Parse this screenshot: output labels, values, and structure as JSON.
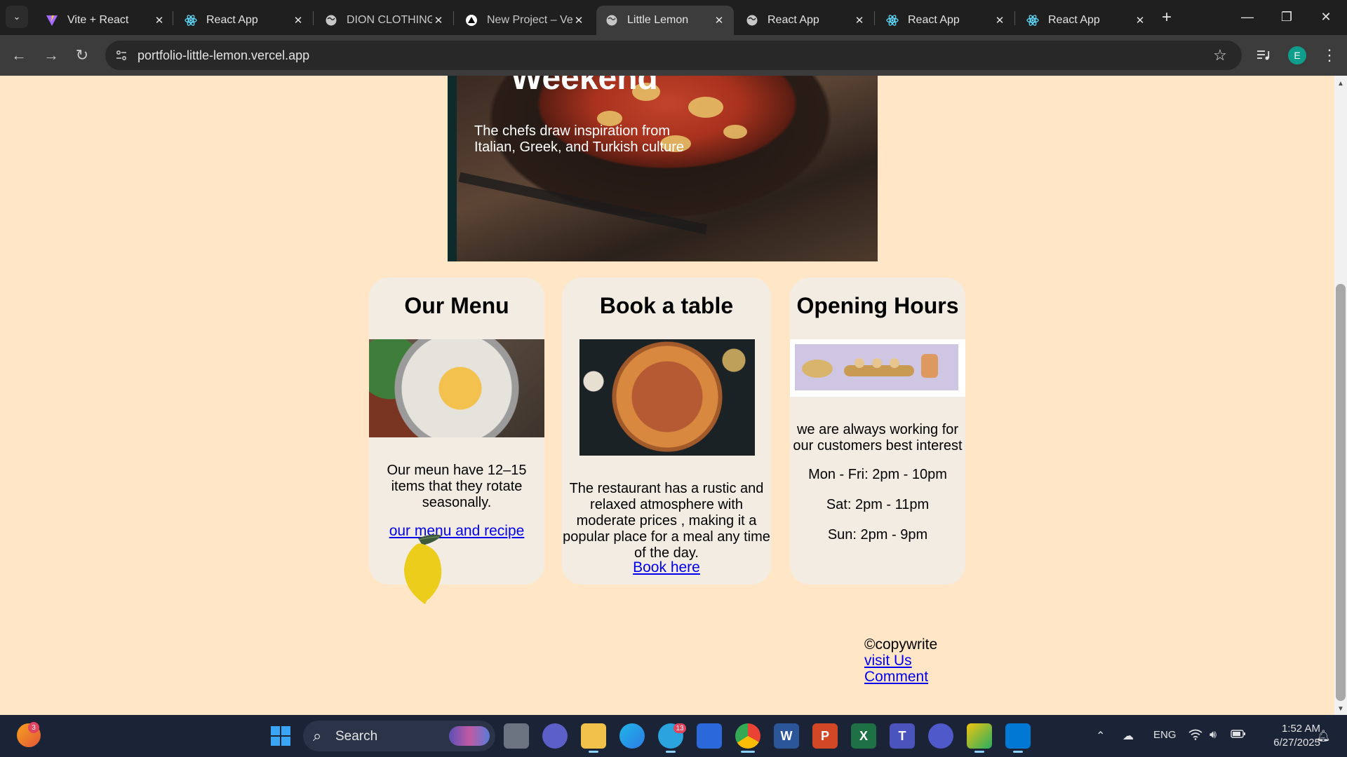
{
  "browser": {
    "tabs": [
      {
        "title": "Vite + React",
        "icon": "vite-icon",
        "active": false
      },
      {
        "title": "React App",
        "icon": "react-icon",
        "active": false
      },
      {
        "title": "DION CLOTHING",
        "icon": "globe-icon",
        "active": false
      },
      {
        "title": "New Project – Ve",
        "icon": "vercel-icon",
        "active": false
      },
      {
        "title": "Little Lemon",
        "icon": "globe-icon",
        "active": true
      },
      {
        "title": "React App",
        "icon": "globe-icon",
        "active": false
      },
      {
        "title": "React App",
        "icon": "react-icon",
        "active": false
      },
      {
        "title": "React App",
        "icon": "react-icon",
        "active": false
      }
    ],
    "url": "portfolio-little-lemon.vercel.app",
    "profile_initial": "E"
  },
  "hero": {
    "title": "Weekend",
    "text": "The chefs draw inspiration from Italian, Greek, and Turkish culture"
  },
  "cards": {
    "menu": {
      "title": "Our Menu",
      "text": "Our meun have 12–15 items that they rotate seasonally.",
      "link": "our menu and recipe"
    },
    "book": {
      "title": "Book a table",
      "text": "The restaurant has a rustic and relaxed atmosphere with moderate prices , making it a popular place for a meal any time of the day.",
      "link": "Book here"
    },
    "hours": {
      "title": "Opening Hours",
      "text": "we are always working for our customers best interest",
      "weekday": "Mon - Fri: 2pm - 10pm",
      "saturday": "Sat: 2pm - 11pm",
      "sunday": "Sun: 2pm - 9pm"
    }
  },
  "footer": {
    "copyright": "©copywrite",
    "visit": "visit Us",
    "comment": "Comment"
  },
  "taskbar": {
    "search_label": "Search",
    "notification_count": "3",
    "telegram_badge": "13",
    "language": "ENG",
    "time": "1:52 AM",
    "date": "6/27/2025"
  },
  "colors": {
    "page_bg": "#ffe6c7",
    "card_bg": "#f3ece2",
    "link": "#0000ee",
    "hero_bg": "#0e2a2a"
  }
}
